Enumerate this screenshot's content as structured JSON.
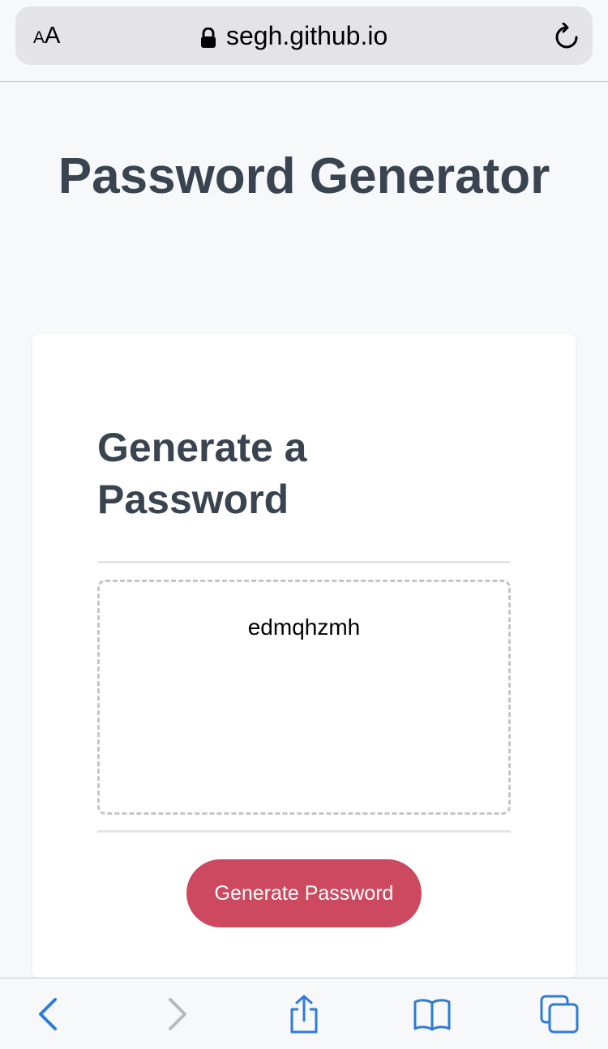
{
  "browser": {
    "text_size_small": "A",
    "text_size_large": "A",
    "url": "segh.github.io",
    "icons": {
      "lock": "lock-icon",
      "reload": "reload-icon"
    }
  },
  "page": {
    "title": "Password Generator"
  },
  "card": {
    "title": "Generate a Password",
    "password_value": "edmqhzmh",
    "button_label": "Generate Password",
    "button_color": "#cc4960"
  },
  "toolbar": {
    "icons": [
      "back-icon",
      "forward-icon",
      "share-icon",
      "bookmarks-icon",
      "tabs-icon"
    ],
    "accent_color": "#2f7bd9",
    "disabled_color": "#b9b9bd"
  }
}
